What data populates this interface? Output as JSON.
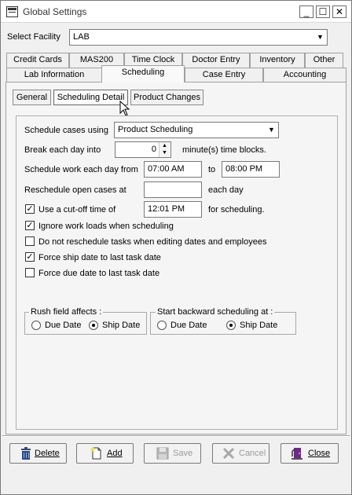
{
  "window": {
    "title": "Global Settings"
  },
  "facility": {
    "label": "Select Facility",
    "value": "LAB"
  },
  "tabs_row1": [
    "Credit Cards",
    "MAS200",
    "Time Clock",
    "Doctor Entry",
    "Inventory",
    "Other"
  ],
  "tabs_row2": [
    "Lab Information",
    "Scheduling",
    "Case Entry",
    "Accounting"
  ],
  "active_tab": "Scheduling",
  "subtabs": [
    "General",
    "Scheduling Detail",
    "Product Changes"
  ],
  "active_subtab": "Scheduling Detail",
  "form": {
    "schedule_using_label": "Schedule cases using",
    "schedule_using_value": "Product Scheduling",
    "break_label": "Break each day into",
    "break_value": "0",
    "break_suffix": "minute(s) time blocks.",
    "work_label": "Schedule work each day from",
    "work_from": "07:00 AM",
    "work_to_label": "to",
    "work_to": "08:00 PM",
    "reschedule_label": "Reschedule open cases at",
    "reschedule_value": "",
    "reschedule_suffix": "each day",
    "cutoff_label": "Use a cut-off time of",
    "cutoff_checked": true,
    "cutoff_value": "12:01 PM",
    "cutoff_suffix": "for scheduling.",
    "checkboxes": [
      {
        "label": "Ignore work loads when scheduling",
        "checked": true
      },
      {
        "label": "Do not reschedule tasks when editing dates and employees",
        "checked": false
      },
      {
        "label": "Force ship date to last task date",
        "checked": true
      },
      {
        "label": "Force due date to last task date",
        "checked": false
      }
    ]
  },
  "rush_group": {
    "title": "Rush field affects :",
    "options": [
      {
        "label": "Due Date",
        "selected": false
      },
      {
        "label": "Ship Date",
        "selected": true
      }
    ]
  },
  "backward_group": {
    "title": "Start backward scheduling at :",
    "options": [
      {
        "label": "Due Date",
        "selected": false
      },
      {
        "label": "Ship Date",
        "selected": true
      }
    ]
  },
  "buttons": {
    "delete": "Delete",
    "add": "Add",
    "save": "Save",
    "cancel": "Cancel",
    "close": "Close"
  },
  "colors": {
    "delete_icon": "#2b4a8a",
    "add_icon": "#f6e24a",
    "close_icon": "#6a2a8a"
  }
}
